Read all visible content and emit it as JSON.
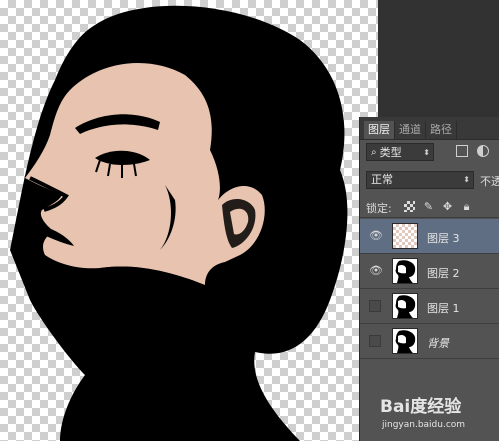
{
  "layers_panel": {
    "tabs": [
      {
        "label": "图层",
        "active": true
      },
      {
        "label": "通道",
        "active": false
      },
      {
        "label": "路径",
        "active": false
      }
    ],
    "filter": {
      "search_icon": "search-icon",
      "value": "类型"
    },
    "blend_mode": {
      "value": "正常"
    },
    "opacity_label": "不透",
    "lock_label": "锁定:",
    "layers": [
      {
        "name": "图层 3",
        "visible": true,
        "selected": true
      },
      {
        "name": "图层 2",
        "visible": true,
        "selected": false
      },
      {
        "name": "图层 1",
        "visible": false,
        "selected": false
      },
      {
        "name": "背景",
        "visible": false,
        "selected": false
      }
    ]
  },
  "canvas": {
    "skin_color": "#e8c4b0",
    "ink_color": "#000000"
  },
  "watermark": {
    "brand": "Bai度经验",
    "url": "jingyan.baidu.com"
  }
}
